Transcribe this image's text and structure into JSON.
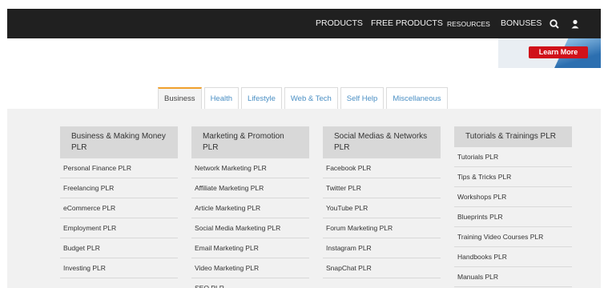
{
  "topnav": {
    "items": [
      {
        "label": "PRODUCTS"
      },
      {
        "label": "FREE PRODUCTS"
      },
      {
        "label": "RESOURCES"
      },
      {
        "label": "BONUSES"
      }
    ],
    "search_icon": "search-icon",
    "user_icon": "user-icon"
  },
  "banner": {
    "button_label": "Learn More"
  },
  "tabs": [
    {
      "label": "Business",
      "active": true
    },
    {
      "label": "Health"
    },
    {
      "label": "Lifestyle"
    },
    {
      "label": "Web & Tech"
    },
    {
      "label": "Self Help"
    },
    {
      "label": "Miscellaneous"
    }
  ],
  "columns": [
    {
      "title": "Business & Making Money PLR",
      "items": [
        "Personal Finance PLR",
        "Freelancing PLR",
        "eCommerce PLR",
        "Employment PLR",
        "Budget PLR",
        "Investing PLR"
      ]
    },
    {
      "title": "Marketing & Promotion PLR",
      "items": [
        "Network Marketing PLR",
        "Affiliate Marketing PLR",
        "Article Marketing PLR",
        "Social Media Marketing PLR",
        "Email Marketing PLR",
        "Video Marketing PLR",
        "SEO PLR"
      ]
    },
    {
      "title": "Social Medias & Networks PLR",
      "items": [
        "Facebook PLR",
        "Twitter PLR",
        "YouTube PLR",
        "Forum Marketing PLR",
        "Instagram PLR",
        "SnapChat PLR"
      ]
    },
    {
      "title": "Tutorials & Trainings PLR",
      "items": [
        "Tutorials PLR",
        "Tips & Tricks PLR",
        "Workshops PLR",
        "Blueprints PLR",
        "Training Video Courses PLR",
        "Handbooks PLR",
        "Manuals PLR"
      ]
    }
  ],
  "colors": {
    "topbar": "#202020",
    "accent_tab": "#f0a02c",
    "link": "#4a8fc4",
    "cta": "#d0121a"
  }
}
